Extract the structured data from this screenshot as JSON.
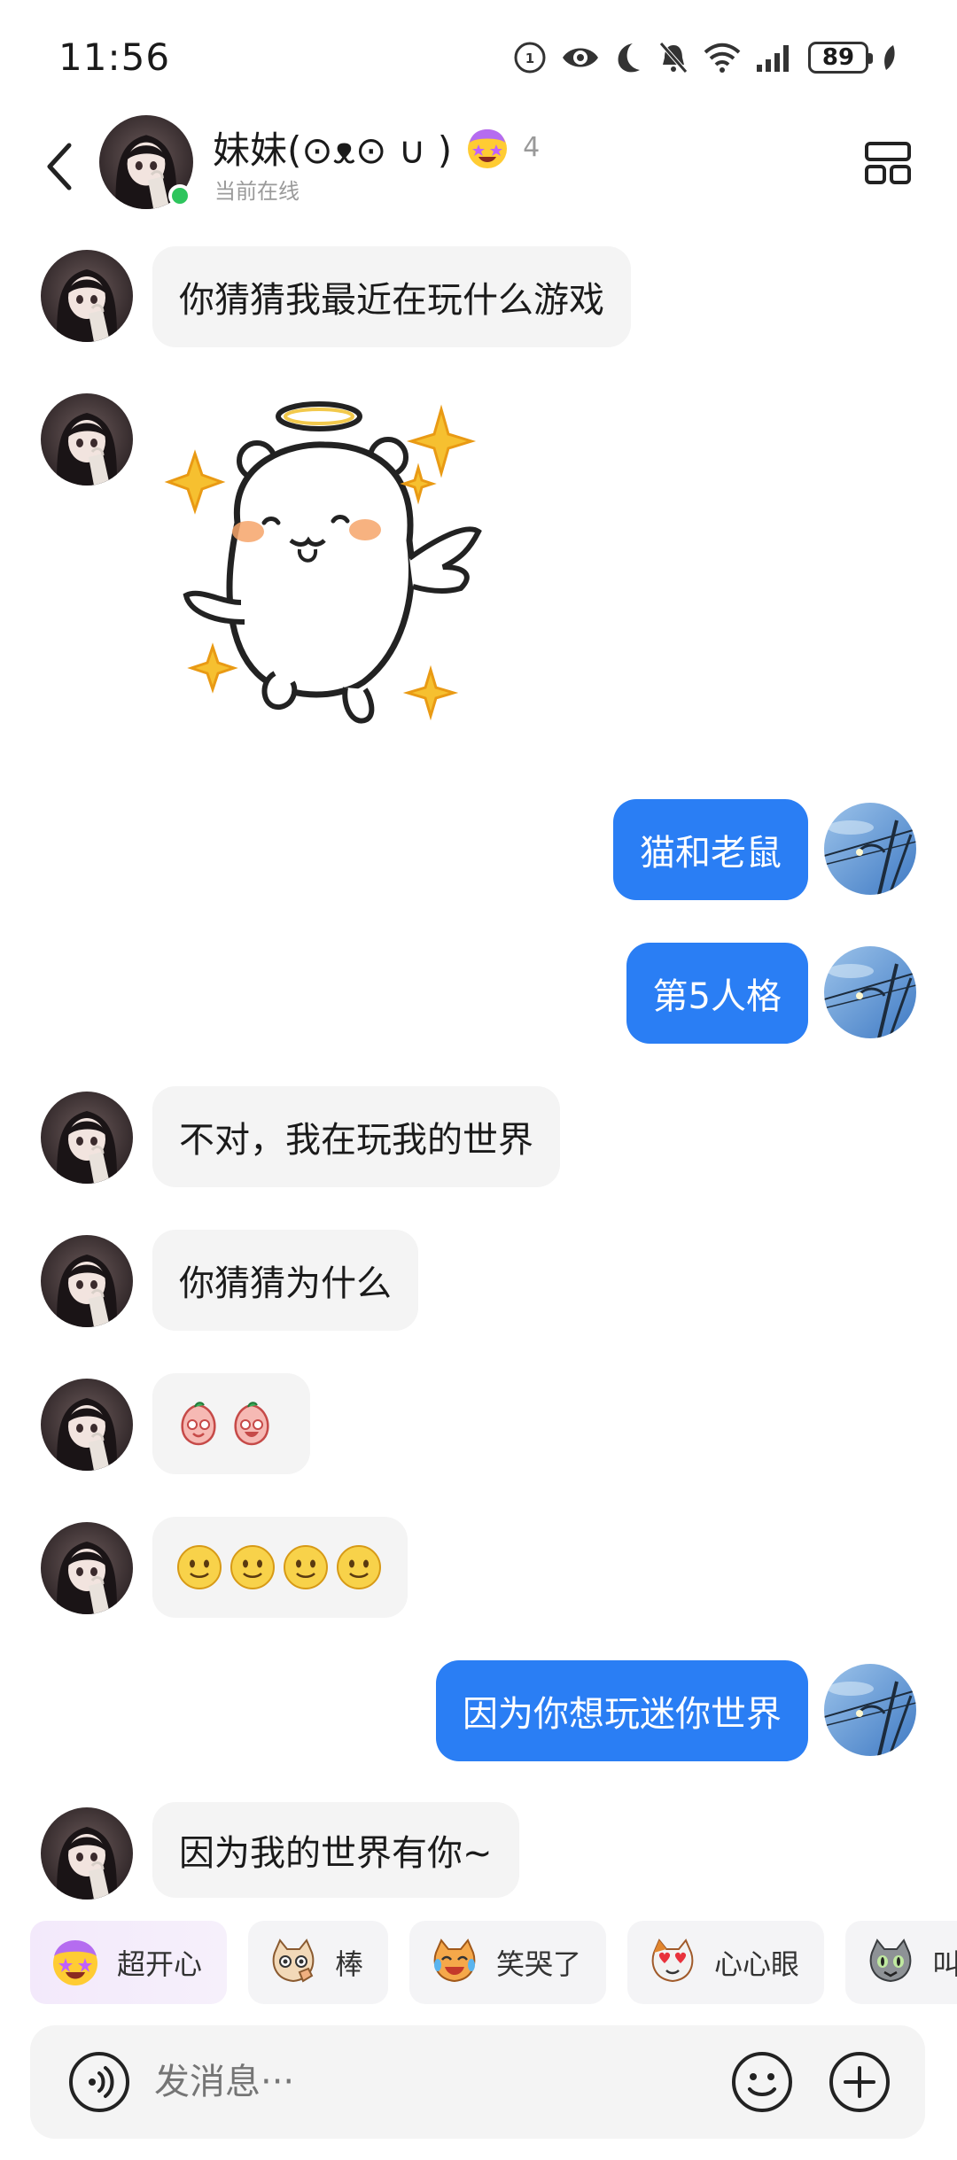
{
  "status_bar": {
    "time": "11:56",
    "battery": "89"
  },
  "header": {
    "contact_name": "妹妹(⊙ᴥ⊙ ∪ )",
    "level": "4",
    "status": "当前在线",
    "back_icon": "chevron-left-icon",
    "menu_icon": "grid-menu-icon"
  },
  "messages": [
    {
      "side": "in",
      "text": "你猜猜我最近在玩什么游戏"
    },
    {
      "side": "in",
      "type": "sticker",
      "icon": "angel-bear-sticker"
    },
    {
      "side": "out",
      "text": "猫和老鼠"
    },
    {
      "side": "out",
      "text": "第5人格"
    },
    {
      "side": "in",
      "text": "不对，我在玩我的世界"
    },
    {
      "side": "in",
      "text": "你猜猜为什么"
    },
    {
      "side": "in",
      "type": "emoji",
      "icon": "peach-face-emoji",
      "count": 2
    },
    {
      "side": "in",
      "type": "emoji",
      "icon": "slight-smile-emoji",
      "count": 4
    },
    {
      "side": "out",
      "text": "因为你想玩迷你世界"
    },
    {
      "side": "in",
      "text": "因为我的世界有你~"
    }
  ],
  "quick_reactions": [
    {
      "label": "超开心",
      "icon": "star-eyes-emoji"
    },
    {
      "label": "棒",
      "icon": "cat-thumbs-up-emoji"
    },
    {
      "label": "笑哭了",
      "icon": "cat-laugh-cry-emoji"
    },
    {
      "label": "心心眼",
      "icon": "cat-heart-eyes-emoji"
    },
    {
      "label": "叫",
      "icon": "gray-cat-emoji"
    }
  ],
  "input": {
    "placeholder": "发消息···",
    "voice_icon": "voice-icon",
    "emoji_icon": "smiley-icon",
    "plus_icon": "plus-icon"
  },
  "colors": {
    "outgoing_bubble": "#2a7ef4",
    "incoming_bubble": "#f4f4f4",
    "online": "#2ec55d"
  }
}
